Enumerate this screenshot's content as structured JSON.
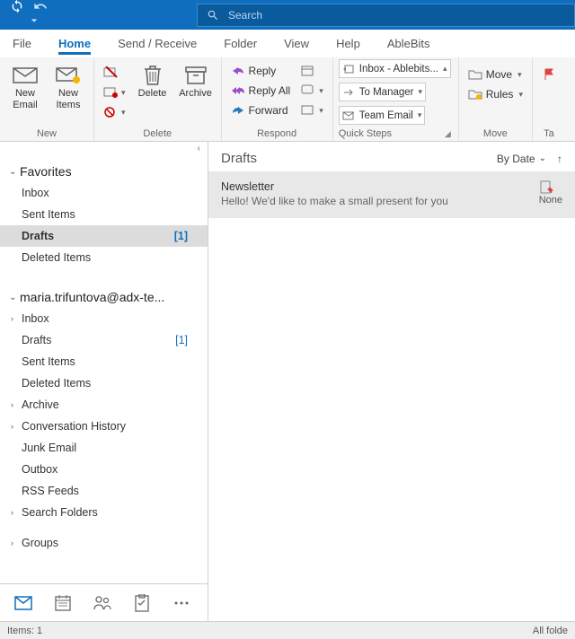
{
  "search": {
    "placeholder": "Search"
  },
  "menutabs": {
    "file": "File",
    "home": "Home",
    "sendrecv": "Send / Receive",
    "folder": "Folder",
    "view": "View",
    "help": "Help",
    "ablebits": "AbleBits"
  },
  "ribbon": {
    "new": {
      "label": "New",
      "newemail": "New\nEmail",
      "newitems": "New\nItems"
    },
    "delete": {
      "label": "Delete",
      "delete": "Delete",
      "archive": "Archive"
    },
    "respond": {
      "label": "Respond",
      "reply": "Reply",
      "replyall": "Reply All",
      "forward": "Forward"
    },
    "quicksteps": {
      "label": "Quick Steps",
      "inbox": "Inbox - Ablebits...",
      "tomgr": "To Manager",
      "team": "Team Email"
    },
    "move": {
      "label": "Move",
      "move": "Move",
      "rules": "Rules"
    },
    "tags": {
      "label": "Ta"
    }
  },
  "nav": {
    "favorites": "Favorites",
    "fav": {
      "inbox": "Inbox",
      "sent": "Sent Items",
      "drafts": "Drafts",
      "drafts_count": "[1]",
      "deleted": "Deleted Items"
    },
    "account": "maria.trifuntova@adx-te...",
    "acc": {
      "inbox": "Inbox",
      "drafts": "Drafts",
      "drafts_count": "[1]",
      "sent": "Sent Items",
      "deleted": "Deleted Items",
      "archive": "Archive",
      "conv": "Conversation History",
      "junk": "Junk Email",
      "outbox": "Outbox",
      "rss": "RSS Feeds",
      "searchf": "Search Folders"
    },
    "groups": "Groups"
  },
  "content": {
    "heading": "Drafts",
    "sort": "By Date",
    "msg": {
      "subject": "Newsletter",
      "preview": "Hello!  We'd like to make a small present for you",
      "cat": "None"
    }
  },
  "status": {
    "left": "Items: 1",
    "right": "All folde"
  }
}
